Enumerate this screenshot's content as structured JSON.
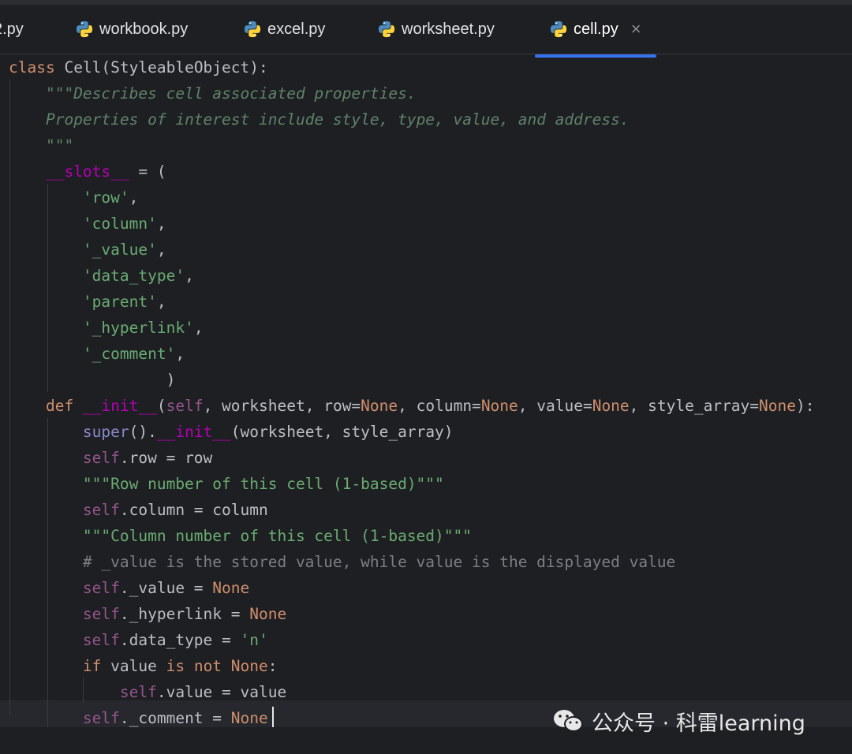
{
  "tabs": [
    {
      "label": "2.py",
      "active": false
    },
    {
      "label": "workbook.py",
      "active": false
    },
    {
      "label": "excel.py",
      "active": false
    },
    {
      "label": "worksheet.py",
      "active": false
    },
    {
      "label": "cell.py",
      "active": true
    }
  ],
  "tab_close_glyph": "×",
  "code": {
    "l1": {
      "kw": "class ",
      "name": "Cell",
      "rest": "(StyleableObject):"
    },
    "l2": {
      "indent": "    ",
      "doc": "\"\"\"Describes cell associated properties."
    },
    "l3": {
      "indent": "    ",
      "doc": "Properties of interest include style, type, value, and address."
    },
    "l4": {
      "indent": "    ",
      "doc": "\"\"\""
    },
    "l5": {
      "indent": "    ",
      "dunder": "__slots__",
      "rest": " = ("
    },
    "l6": {
      "indent": "        ",
      "str": "'row'",
      "rest": ","
    },
    "l7": {
      "indent": "        ",
      "str": "'column'",
      "rest": ","
    },
    "l8": {
      "indent": "        ",
      "str": "'_value'",
      "rest": ","
    },
    "l9": {
      "indent": "        ",
      "str": "'data_type'",
      "rest": ","
    },
    "l10": {
      "indent": "        ",
      "str": "'parent'",
      "rest": ","
    },
    "l11": {
      "indent": "        ",
      "str": "'_hyperlink'",
      "rest": ","
    },
    "l12": {
      "indent": "        ",
      "str": "'_comment'",
      "rest": ","
    },
    "l13": {
      "indent": "                 ",
      "rest": ")"
    },
    "l14": {
      "indent": "    ",
      "kw": "def ",
      "dunder": "__init__",
      "p1": "(",
      "self": "self",
      "p2": ", worksheet, row=",
      "n1": "None",
      "p3": ", column=",
      "n2": "None",
      "p4": ", value=",
      "n3": "None",
      "p5": ", style_array=",
      "n4": "None",
      "p6": "):"
    },
    "l15": {
      "indent": "        ",
      "bi": "super",
      "p1": "().",
      "dunder": "__init__",
      "p2": "(worksheet, style_array)"
    },
    "l16": {
      "indent": "        ",
      "self": "self",
      "rest": ".row = row"
    },
    "l17": {
      "indent": "        ",
      "str": "\"\"\"Row number of this cell (1-based)\"\"\""
    },
    "l18": {
      "indent": "        ",
      "self": "self",
      "rest": ".column = column"
    },
    "l19": {
      "indent": "        ",
      "str": "\"\"\"Column number of this cell (1-based)\"\"\""
    },
    "l20": {
      "indent": "        ",
      "cmt": "# _value is the stored value, while value is the displayed value"
    },
    "l21": {
      "indent": "        ",
      "self": "self",
      "rest": "._value = ",
      "kw2": "None"
    },
    "l22": {
      "indent": "        ",
      "self": "self",
      "rest": "._hyperlink = ",
      "kw2": "None"
    },
    "l23": {
      "indent": "        ",
      "self": "self",
      "rest": ".data_type = ",
      "str": "'n'"
    },
    "l24": {
      "indent": "        ",
      "kw": "if ",
      "rest1": "value ",
      "kw2": "is not ",
      "kw3": "None",
      "rest2": ":"
    },
    "l25": {
      "indent": "            ",
      "self": "self",
      "rest": ".value = value"
    },
    "l26": {
      "indent": "        ",
      "self": "self",
      "rest": "._comment = ",
      "kw2": "None"
    }
  },
  "watermark": {
    "text": "公众号 · 科雷learning"
  },
  "colors": {
    "keyword": "#cf8e6d",
    "string": "#6aab73",
    "docstring": "#5f826b",
    "self": "#94558d",
    "dunder": "#b200b2",
    "accent": "#3574f0"
  }
}
